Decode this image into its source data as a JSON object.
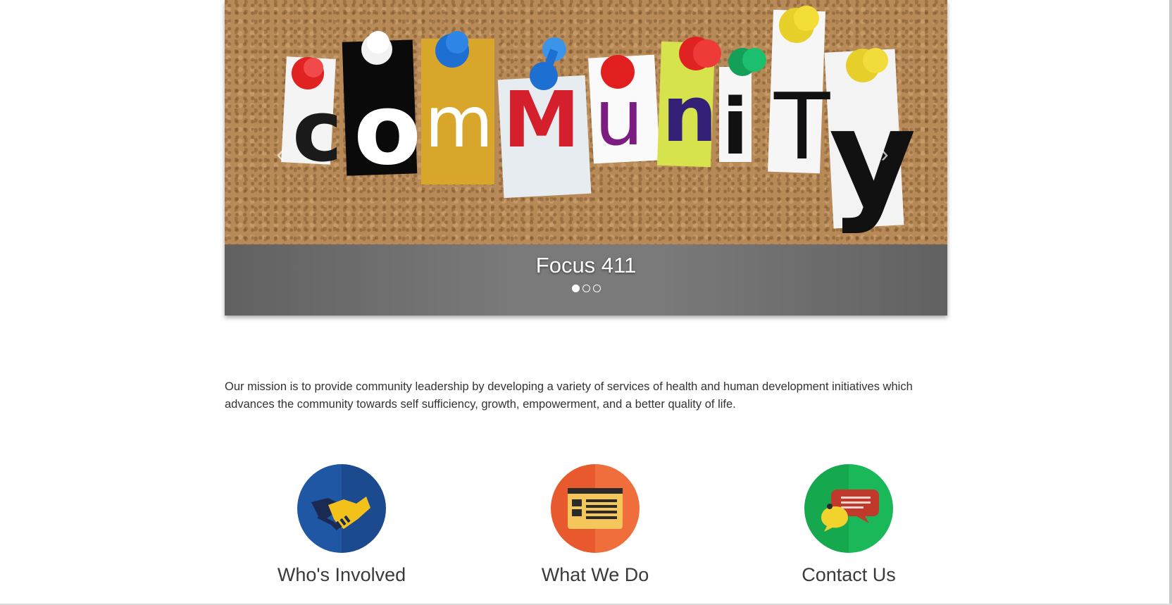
{
  "carousel": {
    "caption": "Focus 411",
    "slide_count": 3,
    "active_slide": 1,
    "prev_label": "‹",
    "next_label": "›",
    "banner_letters": [
      "c",
      "o",
      "m",
      "M",
      "u",
      "n",
      "i",
      "T",
      "y"
    ]
  },
  "mission": {
    "text": "Our mission is to provide community leadership by developing a variety of services of health and human development initiatives which advances the community towards self sufficiency, growth, empowerment, and a better quality of life."
  },
  "features": [
    {
      "label": "Who's Involved",
      "icon": "handshake-icon",
      "color": "#2057a5"
    },
    {
      "label": "What We Do",
      "icon": "browser-window-icon",
      "color": "#e8592d"
    },
    {
      "label": "Contact Us",
      "icon": "chat-bubbles-icon",
      "color": "#15a84e"
    }
  ]
}
